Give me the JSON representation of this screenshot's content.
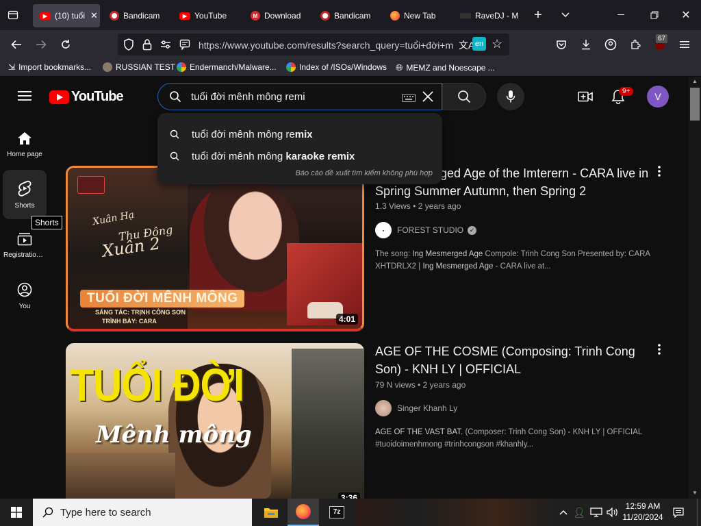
{
  "browser": {
    "tabs": [
      {
        "label": "(10) tuổi",
        "icon": "youtube-icon",
        "color": "#ff0000",
        "active": true
      },
      {
        "label": "Bandicam",
        "icon": "bandicam-icon",
        "color": "#e53935"
      },
      {
        "label": "YouTube",
        "icon": "youtube-icon",
        "color": "#ff0000"
      },
      {
        "label": "Download",
        "icon": "mega-icon",
        "color": "#d9272e"
      },
      {
        "label": "Bandicam",
        "icon": "bandicam-icon",
        "color": "#e53935"
      },
      {
        "label": "New Tab",
        "icon": "firefox-icon",
        "color": "#ff7139"
      },
      {
        "label": "RaveDJ - M",
        "icon": "ravedj-icon",
        "color": "#333333"
      }
    ],
    "url": "https://www.youtube.com/results?search_query=tuổi+đời+m",
    "translate_badge": "en",
    "extensions_count": "67",
    "bookmarks": [
      {
        "label": "Import bookmarks...",
        "icon": "import-icon"
      },
      {
        "label": "RUSSIAN TEST",
        "icon": "avatar-icon"
      },
      {
        "label": "Endermanch/Malware...",
        "icon": "google-icon"
      },
      {
        "label": "Index of /ISOs/Windows",
        "icon": "google-icon"
      },
      {
        "label": "MEMZ and Noescape ...",
        "icon": "globe-icon"
      }
    ]
  },
  "youtube": {
    "logo_text": "YouTube",
    "search_value": "tuổi đời mênh mông remi",
    "notif_count": "9+",
    "avatar_letter": "V",
    "suggestions": [
      {
        "prefix": "tuổi đời mênh mông re",
        "bold": "mix"
      },
      {
        "prefix": "tuổi đời mênh mông ",
        "bold": "karaoke remix"
      }
    ],
    "report_text": "Báo cáo đề xuất tìm kiếm không phù hợp",
    "sidebar": [
      {
        "label": "Home page",
        "icon": "home-icon"
      },
      {
        "label": "Shorts",
        "icon": "shorts-icon"
      },
      {
        "label": "Registration ...",
        "icon": "subscriptions-icon"
      },
      {
        "label": "You",
        "icon": "you-icon"
      }
    ],
    "tooltip": "Shorts",
    "videos": [
      {
        "title": "Ing Mesmerged Age of the Imterern - CARA live in Spring Summer Autumn, then Spring 2",
        "views": "1.3 Views",
        "age": "2 years ago",
        "channel": "FOREST STUDIO",
        "verified": true,
        "duration": "4:01",
        "desc_pre": "The song: ",
        "desc_b1": "Ing Mesmerged Age",
        "desc_mid": " Compole: Trinh Cong Son Presented by: CARA XHTDRLX2 | ",
        "desc_b2": "Ing Mesmerged Age",
        "desc_post": " - CARA live at...",
        "thumb_title": "TUỔI ĐỜI MÊNH MÔNG",
        "thumb_script1": "Xuân Hạ",
        "thumb_script2": "Thu Đông",
        "thumb_script3": "Xuân 2",
        "thumb_sub1": "SÁNG TÁC: TRỊNH CÔNG SƠN",
        "thumb_sub2": "TRÌNH BÀY: CARA"
      },
      {
        "title": "AGE OF THE COSME (Composing: Trinh Cong Son) - KNH LY | OFFICIAL",
        "views": "79 N views",
        "age": "2 years ago",
        "channel": "Singer Khanh Ly",
        "duration": "3:36",
        "desc_b1": "AGE OF THE VAST BAT.",
        "desc_mid": " (Composer: Trinh Cong Son) - KNH LY | OFFICIAL",
        "desc_line2": "#tuoidoimenhmong #trinhcongson #khanhly...",
        "thumb_title": "TUỔI ĐỜI",
        "thumb_script": "Mênh mông"
      }
    ]
  },
  "taskbar": {
    "search_placeholder": "Type here to search",
    "time": "12:59 AM",
    "date": "11/20/2024",
    "apps": [
      "file-explorer-icon",
      "firefox-icon",
      "7zip-icon"
    ]
  }
}
